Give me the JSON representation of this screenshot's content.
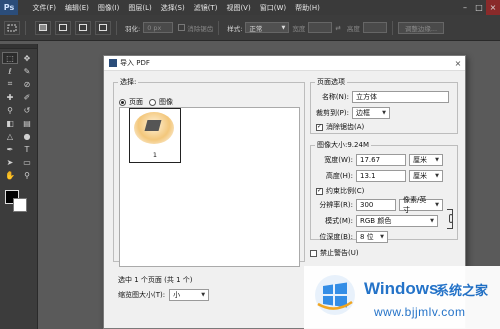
{
  "app": {
    "logo": "Ps",
    "menus": [
      "文件(F)",
      "编辑(E)",
      "图像(I)",
      "图层(L)",
      "选择(S)",
      "滤镜(T)",
      "视图(V)",
      "窗口(W)",
      "帮助(H)"
    ],
    "window_controls": [
      "–",
      "□",
      "×"
    ]
  },
  "options_bar": {
    "feather_value": "0 px",
    "antialias_label": "消除锯齿",
    "style_label": "样式:",
    "style_value": "正常",
    "width_label": "宽度",
    "height_label": "高度",
    "refine_edge_label": "调整边缘..."
  },
  "toolbox": {
    "tools": [
      "marquee",
      "move",
      "lasso",
      "quick-select",
      "crop",
      "eyedropper",
      "healing",
      "brush",
      "clone-stamp",
      "history-brush",
      "eraser",
      "gradient",
      "blur",
      "dodge",
      "pen",
      "type",
      "path-select",
      "shape",
      "hand",
      "zoom"
    ],
    "foreground_color": "#000000",
    "background_color": "#ffffff"
  },
  "dialog": {
    "title": "导入 PDF",
    "close_label": "×",
    "select_group": {
      "legend": "选择:",
      "radio_page": "页面",
      "radio_image": "图像",
      "selected": "页面",
      "thumbnail_number": "1"
    },
    "status": "选中 1 个页面 (共 1 个)",
    "thumbnail_size_label": "缩览图大小(T):",
    "thumbnail_size_value": "小",
    "page_options": {
      "legend": "页面选项",
      "name_label": "名称(N):",
      "name_value": "立方体",
      "crop_label": "裁剪到(P):",
      "crop_value": "边框",
      "antialias_label": "消除锯齿(A)",
      "antialias_checked": true
    },
    "image_size": {
      "legend": "图像大小:9.24M",
      "width_label": "宽度(W):",
      "width_value": "17.67",
      "width_unit": "厘米",
      "height_label": "高度(H):",
      "height_value": "13.1",
      "height_unit": "厘米",
      "constrain_label": "约束比例(C)",
      "constrain_checked": true,
      "resolution_label": "分辨率(R):",
      "resolution_value": "300",
      "resolution_unit": "像素/英寸",
      "mode_label": "模式(M):",
      "mode_value": "RGB 颜色",
      "bitdepth_label": "位深度(B):",
      "bitdepth_value": "8 位"
    },
    "suppress_warnings_label": "禁止警告(U)",
    "suppress_warnings_checked": false
  },
  "watermark": {
    "title": "Windows",
    "cn": "系统之家",
    "url": "www.bjjmlv.com"
  }
}
